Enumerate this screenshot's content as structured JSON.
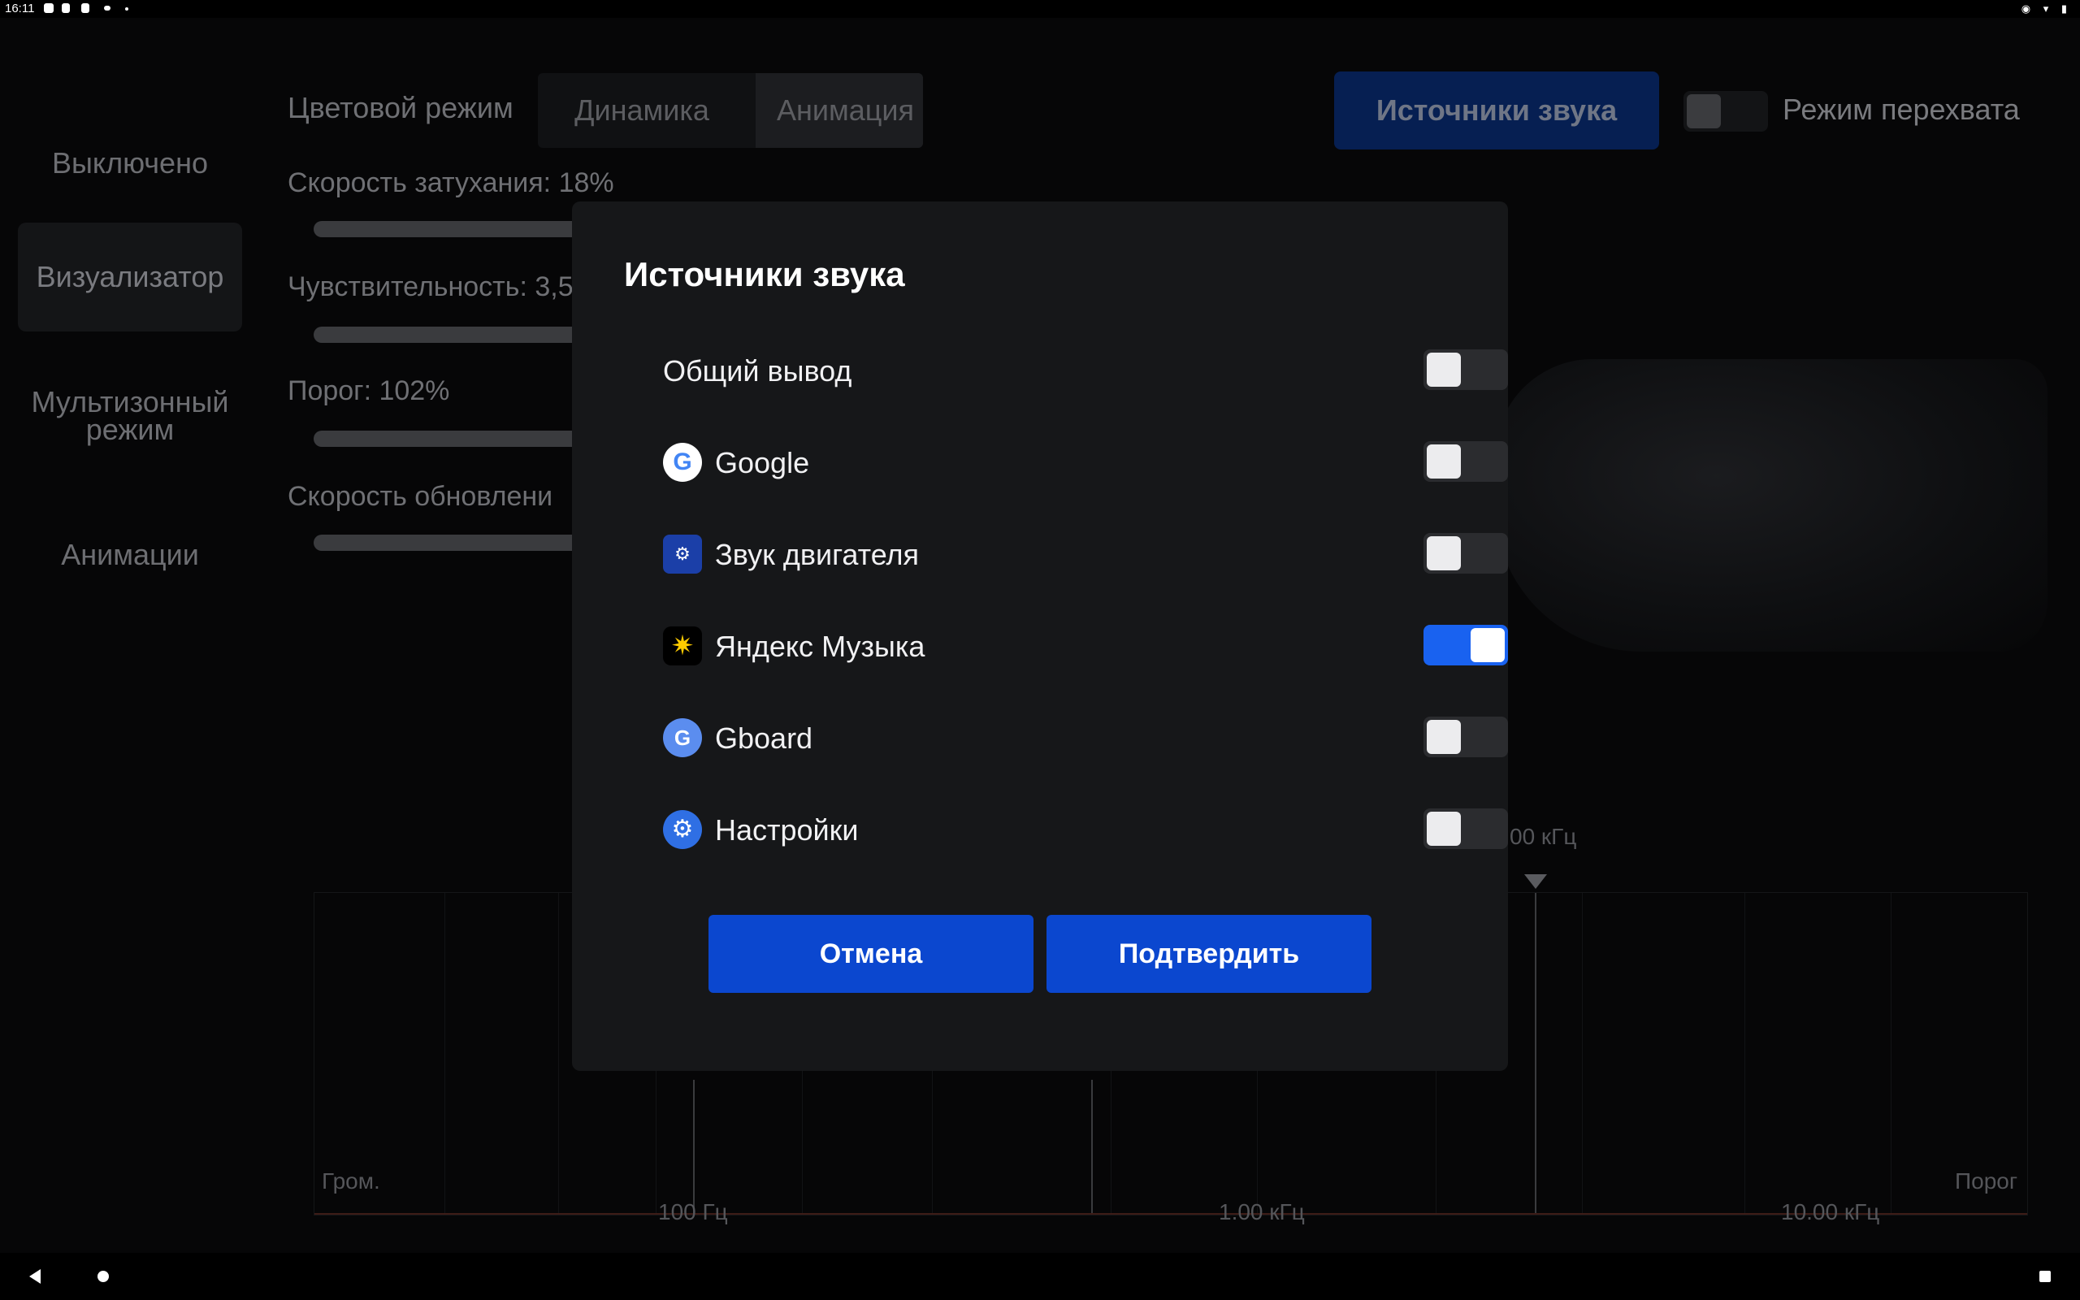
{
  "status_bar": {
    "time": "16:11"
  },
  "sidebar": {
    "items": [
      {
        "label": "Выключено"
      },
      {
        "label": "Визуализатор",
        "active": true
      },
      {
        "label": "Мультизонный режим"
      },
      {
        "label": "Анимации"
      }
    ]
  },
  "header": {
    "color_mode_label": "Цветовой режим",
    "segments": [
      {
        "label": "Динамика"
      },
      {
        "label": "Анимация",
        "active": true
      }
    ],
    "sources_button": "Источники звука",
    "intercept_label": "Режим перехвата",
    "intercept_on": false
  },
  "params": {
    "fade_speed": "Скорость затухания: 18%",
    "sensitivity": "Чувствительность: 3,5",
    "threshold": "Порог: 102%",
    "refresh_speed": "Скорость обновлени"
  },
  "chart": {
    "marker_label": "00 кГц",
    "left_label": "Гром.",
    "right_label": "Порог",
    "ticks": [
      "100 Гц",
      "1.00 кГц",
      "10.00 кГц"
    ]
  },
  "dialog": {
    "title": "Источники звука",
    "rows": [
      {
        "label": "Общий вывод",
        "icon": "none",
        "on": false
      },
      {
        "label": "Google",
        "icon": "google-icon",
        "on": false
      },
      {
        "label": "Звук двигателя",
        "icon": "engine-sound-icon",
        "on": false
      },
      {
        "label": "Яндекс Музыка",
        "icon": "yandex-music-icon",
        "on": true
      },
      {
        "label": "Gboard",
        "icon": "gboard-icon",
        "on": false
      },
      {
        "label": "Настройки",
        "icon": "settings-icon",
        "on": false
      }
    ],
    "cancel": "Отмена",
    "confirm": "Подтвердить"
  },
  "colors": {
    "accent": "#0b47cf",
    "toggle_on": "#1962f0",
    "dialog_bg": "#161719"
  }
}
